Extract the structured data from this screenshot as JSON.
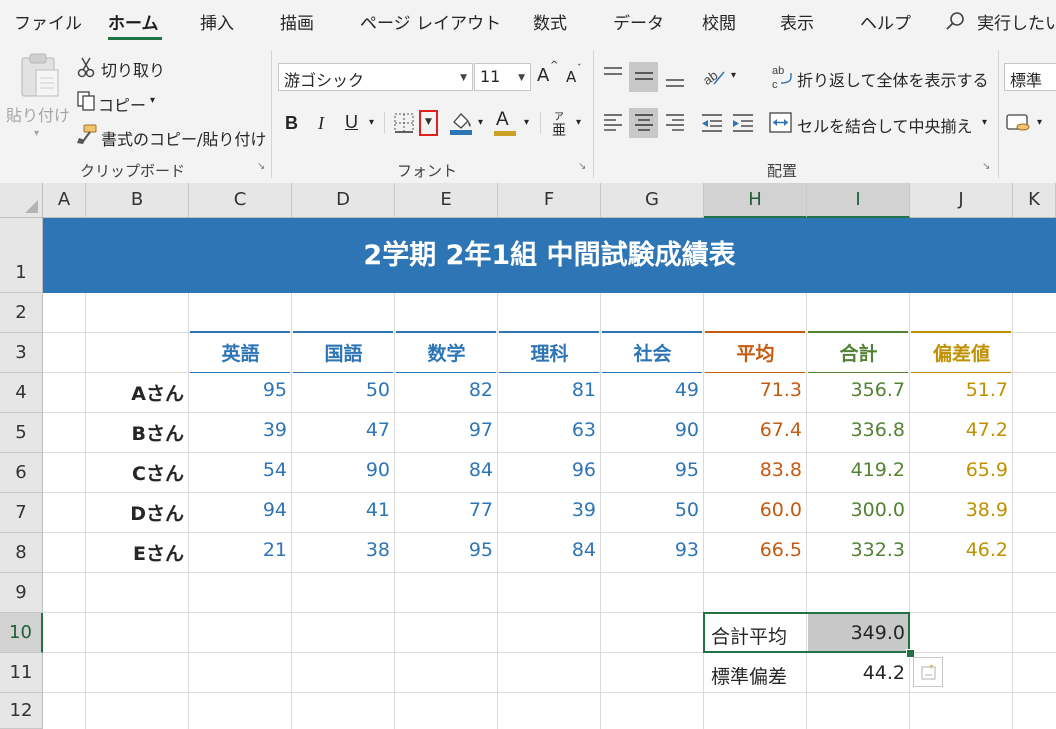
{
  "menu": {
    "tabs": [
      "ファイル",
      "ホーム",
      "挿入",
      "描画",
      "ページ レイアウト",
      "数式",
      "データ",
      "校閲",
      "表示",
      "ヘルプ"
    ],
    "search_label": "実行したい"
  },
  "clipboard": {
    "paste_label": "貼り付け",
    "cut_label": "切り取り",
    "copy_label": "コピー",
    "format_painter_label": "書式のコピー/貼り付け",
    "group_label": "クリップボード"
  },
  "font": {
    "font_name": "游ゴシック",
    "font_size": "11",
    "grow_label": "A",
    "shrink_label": "A",
    "bold_label": "B",
    "italic_label": "I",
    "underline_label": "U",
    "font_color_label": "A",
    "phonetic_top": "ア",
    "phonetic_bottom": "亜",
    "group_label": "フォント",
    "fill_color": "#2e75b6",
    "font_color": "#c9a227"
  },
  "alignment": {
    "wrap_text_label": "折り返して全体を表示する",
    "merge_center_label": "セルを結合して中央揃え",
    "group_label": "配置"
  },
  "number": {
    "format_value": "標準"
  },
  "sheet": {
    "columns": [
      "A",
      "B",
      "C",
      "D",
      "E",
      "F",
      "G",
      "H",
      "I",
      "J",
      "K"
    ],
    "rows": [
      "1",
      "2",
      "3",
      "4",
      "5",
      "6",
      "7",
      "8",
      "9",
      "10",
      "11",
      "12"
    ],
    "title": "2学期 2年1組 中間試験成績表",
    "headers": {
      "subjects": [
        "英語",
        "国語",
        "数学",
        "理科",
        "社会"
      ],
      "average": "平均",
      "total": "合計",
      "deviation": "偏差値"
    },
    "students": [
      {
        "name": "Aさん",
        "scores": [
          "95",
          "50",
          "82",
          "81",
          "49"
        ],
        "average": "71.3",
        "total": "356.7",
        "deviation": "51.7"
      },
      {
        "name": "Bさん",
        "scores": [
          "39",
          "47",
          "97",
          "63",
          "90"
        ],
        "average": "67.4",
        "total": "336.8",
        "deviation": "47.2"
      },
      {
        "name": "Cさん",
        "scores": [
          "54",
          "90",
          "84",
          "96",
          "95"
        ],
        "average": "83.8",
        "total": "419.2",
        "deviation": "65.9"
      },
      {
        "name": "Dさん",
        "scores": [
          "94",
          "41",
          "77",
          "39",
          "50"
        ],
        "average": "60.0",
        "total": "300.0",
        "deviation": "38.9"
      },
      {
        "name": "Eさん",
        "scores": [
          "21",
          "38",
          "95",
          "84",
          "93"
        ],
        "average": "66.5",
        "total": "332.3",
        "deviation": "46.2"
      }
    ],
    "summary": [
      {
        "label": "合計平均",
        "value": "349.0"
      },
      {
        "label": "標準偏差",
        "value": "44.2"
      }
    ],
    "colors": {
      "title_band": "#2e75b6",
      "subject": "#2e75b6",
      "average": "#c55a11",
      "total": "#548235",
      "deviation": "#bf9000",
      "selection": "#217346"
    }
  }
}
